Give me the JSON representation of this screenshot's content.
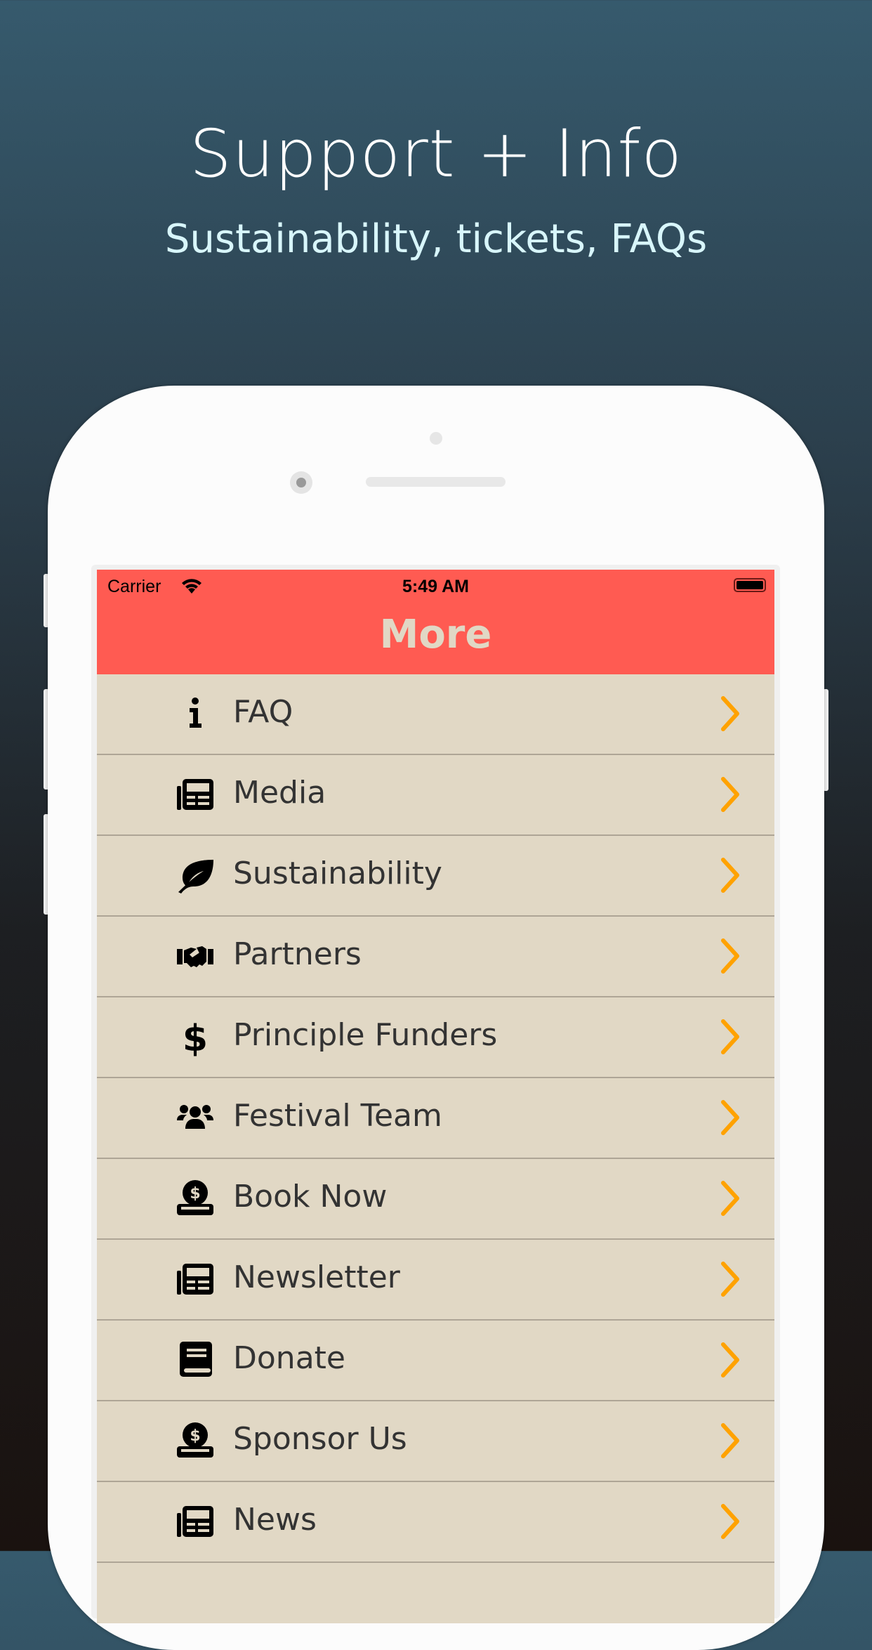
{
  "hero": {
    "title": "Support + Info",
    "subtitle": "Sustainability, tickets, FAQs"
  },
  "status_bar": {
    "carrier": "Carrier",
    "time": "5:49 AM"
  },
  "nav": {
    "title": "More"
  },
  "colors": {
    "header": "#ff5b52",
    "row_bg": "#e1d8c5",
    "chevron": "#ffa200"
  },
  "menu": [
    {
      "label": "FAQ",
      "icon": "info-icon"
    },
    {
      "label": "Media",
      "icon": "newspaper-icon"
    },
    {
      "label": "Sustainability",
      "icon": "leaf-icon"
    },
    {
      "label": "Partners",
      "icon": "handshake-icon"
    },
    {
      "label": "Principle Funders",
      "icon": "dollar-icon"
    },
    {
      "label": "Festival Team",
      "icon": "users-icon"
    },
    {
      "label": "Book Now",
      "icon": "donate-icon"
    },
    {
      "label": "Newsletter",
      "icon": "newspaper-icon"
    },
    {
      "label": "Donate",
      "icon": "book-icon"
    },
    {
      "label": "Sponsor Us",
      "icon": "donate-icon"
    },
    {
      "label": "News",
      "icon": "newspaper-icon"
    }
  ]
}
